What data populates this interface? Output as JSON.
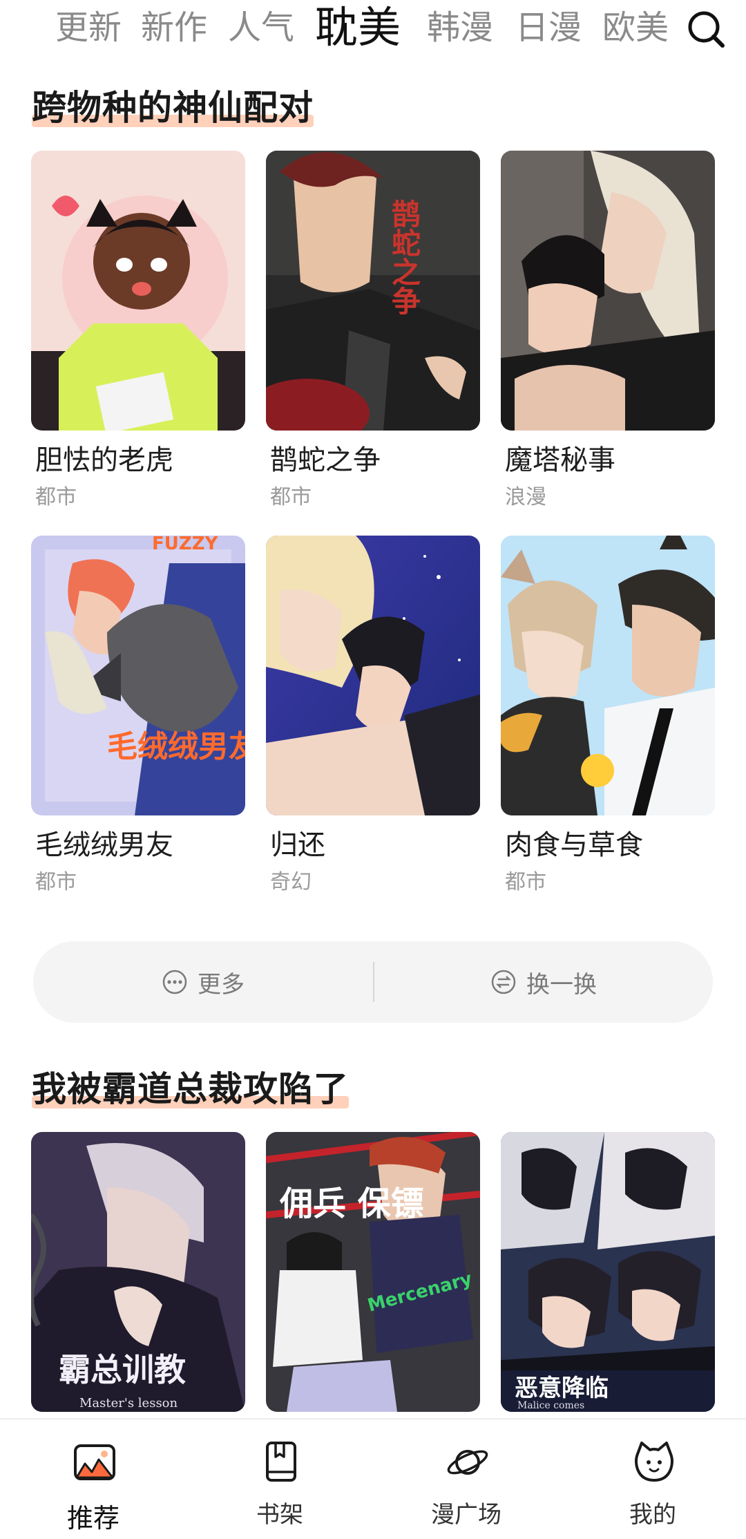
{
  "tabs": [
    {
      "label": "更新",
      "active": false
    },
    {
      "label": "新作",
      "active": false
    },
    {
      "label": "人气",
      "active": false
    },
    {
      "label": "耽美",
      "active": true
    },
    {
      "label": "韩漫",
      "active": false
    },
    {
      "label": "日漫",
      "active": false
    },
    {
      "label": "欧美",
      "active": false
    }
  ],
  "sections": [
    {
      "title": "跨物种的神仙配对",
      "items": [
        {
          "title": "胆怯的老虎",
          "tag": "都市"
        },
        {
          "title": "鹊蛇之争",
          "tag": "都市"
        },
        {
          "title": "魔塔秘事",
          "tag": "浪漫"
        },
        {
          "title": "毛绒绒男友",
          "tag": "都市"
        },
        {
          "title": "归还",
          "tag": "奇幻"
        },
        {
          "title": "肉食与草食",
          "tag": "都市"
        }
      ],
      "more_label": "更多",
      "refresh_label": "换一换"
    },
    {
      "title": "我被霸道总裁攻陷了",
      "items": [
        {
          "title": "",
          "tag": ""
        },
        {
          "title": "",
          "tag": ""
        },
        {
          "title": "",
          "tag": ""
        }
      ]
    }
  ],
  "cover_text": {
    "c2": "鹊蛇之争",
    "c4": "毛绒绒男友",
    "c4_top": "FUZZY",
    "c7": "霸总训教",
    "c7_sub": "Master's lesson",
    "c8": "佣兵 保镖",
    "c8_sub": "Mercenary",
    "c9": "恶意降临",
    "c9_sub": "Malice comes"
  },
  "bottom_nav": [
    {
      "label": "推荐",
      "icon": "recommend-icon",
      "active": true
    },
    {
      "label": "书架",
      "icon": "bookshelf-icon",
      "active": false
    },
    {
      "label": "漫广场",
      "icon": "planet-icon",
      "active": false
    },
    {
      "label": "我的",
      "icon": "cat-face-icon",
      "active": false
    }
  ],
  "colors": {
    "accent": "#ff6a3d",
    "highlight": "#ffb48c"
  }
}
